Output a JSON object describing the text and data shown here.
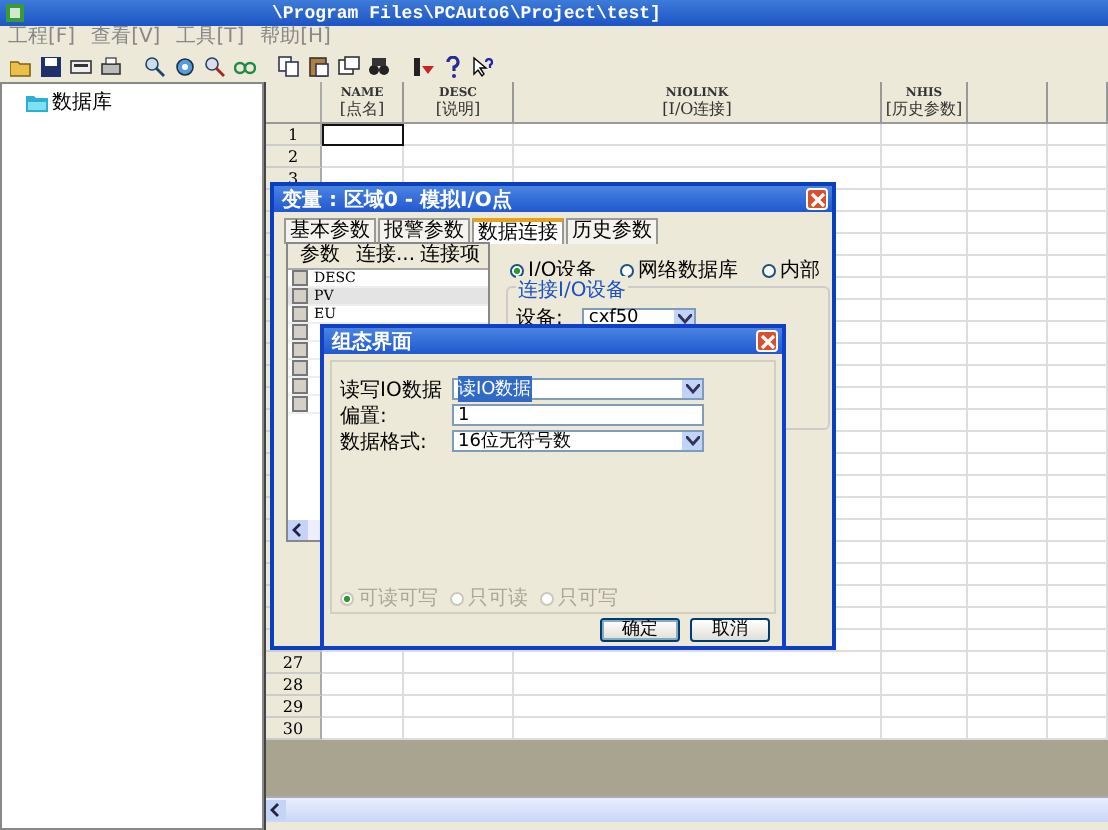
{
  "window": {
    "title": "\\Program Files\\PCAuto6\\Project\\test]"
  },
  "menu": [
    "工程[F]",
    "查看[V]",
    "工具[T]",
    "帮助[H]"
  ],
  "tree": {
    "items": [
      {
        "label": "数据库"
      }
    ]
  },
  "grid": {
    "columns": [
      {
        "code": "NAME",
        "label": "[点名]"
      },
      {
        "code": "DESC",
        "label": "[说明]"
      },
      {
        "code": "NIOLINK",
        "label": "[I/O连接]"
      },
      {
        "code": "NHIS",
        "label": "[历史参数]"
      }
    ],
    "rows_top": [
      {
        "label": "1",
        "selected": true
      },
      {
        "label": "2",
        "selected": false
      },
      {
        "label": "3",
        "selected": false
      }
    ],
    "rows_bottom": [
      {
        "label": "27",
        "selected": false
      },
      {
        "label": "28",
        "selected": false
      },
      {
        "label": "29",
        "selected": false
      },
      {
        "label": "30",
        "selected": false
      }
    ]
  },
  "tag_dialog": {
    "title": "变量 : 区域0 - 模拟I/O点",
    "tabs": [
      {
        "label": "基本参数",
        "selected": false
      },
      {
        "label": "报警参数",
        "selected": false
      },
      {
        "label": "数据连接",
        "selected": true
      },
      {
        "label": "历史参数",
        "selected": false
      }
    ],
    "list": {
      "columns": [
        "参数",
        "连接...",
        "连接项"
      ],
      "rows": [
        {
          "label": "DESC",
          "selected": false,
          "checked": false
        },
        {
          "label": "PV",
          "selected": true,
          "checked": false
        },
        {
          "label": "EU",
          "selected": false,
          "checked": false
        },
        {
          "selected": false,
          "checked": false
        },
        {
          "selected": false,
          "checked": false
        },
        {
          "selected": false,
          "checked": false
        },
        {
          "selected": false,
          "checked": false
        },
        {
          "selected": false,
          "checked": false
        }
      ]
    },
    "source_options": [
      {
        "label": "I/O设备",
        "selected": true
      },
      {
        "label": "网络数据库",
        "selected": false
      },
      {
        "label": "内部",
        "selected": false
      }
    ],
    "io_group": {
      "title": "连接I/O设备",
      "device_label": "设备:",
      "device_value": "cxf50"
    }
  },
  "config_dialog": {
    "title": "组态界面",
    "fields": [
      {
        "label": "读写IO数据",
        "kind": "combo",
        "value": "读IO数据",
        "highlighted": true
      },
      {
        "label": "偏置:",
        "kind": "text",
        "value": "1",
        "highlighted": false
      },
      {
        "label": "数据格式:",
        "kind": "combo",
        "value": "16位无符号数",
        "highlighted": false
      }
    ],
    "access_options": [
      {
        "label": "可读可写",
        "selected": true,
        "disabled": true
      },
      {
        "label": "只可读",
        "selected": false,
        "disabled": true
      },
      {
        "label": "只可写",
        "selected": false,
        "disabled": true
      }
    ],
    "buttons": [
      "确定",
      "取消"
    ]
  }
}
